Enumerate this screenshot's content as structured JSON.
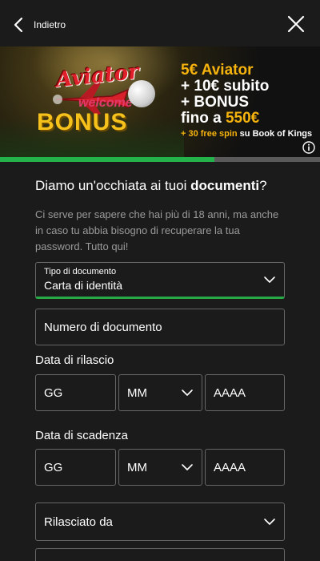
{
  "header": {
    "back_label": "Indietro"
  },
  "banner": {
    "logo_text": "Aviator",
    "welcome_text": "welcome",
    "bonus_text": "BONUS",
    "promo": {
      "line1": "5€ Aviator",
      "line2": "+ 10€ subito",
      "line3": "+ BONUS",
      "line4_prefix": "fino a ",
      "line4_amount": "550€",
      "line5_prefix": "+ 30 free spin",
      "line5_suffix": " su Book of Kings"
    }
  },
  "progress": {
    "value": 0.67,
    "fill_color": "#24b24a",
    "track_color": "#5a5a5a"
  },
  "form": {
    "heading_prefix": "Diamo un'occhiata ai tuoi ",
    "heading_bold": "documenti",
    "heading_suffix": "?",
    "description": "Ci serve per sapere che hai più di 18 anni, ma anche in caso tu abbia bisogno di recuperare la tua password. Tutto qui!",
    "doc_type": {
      "label": "Tipo di documento",
      "value": "Carta di identità"
    },
    "doc_number": {
      "placeholder": "Numero di documento",
      "value": ""
    },
    "issue_date": {
      "label": "Data di rilascio",
      "day_placeholder": "GG",
      "month_value": "MM",
      "year_placeholder": "AAAA"
    },
    "expiry_date": {
      "label": "Data di scadenza",
      "day_placeholder": "GG",
      "month_value": "MM",
      "year_placeholder": "AAAA"
    },
    "issued_by": {
      "value": "Rilasciato da"
    }
  },
  "colors": {
    "background": "#1b1b1b",
    "accent_green": "#27a946",
    "promo_gold": "#f6b30e",
    "field_border": "#666666"
  },
  "icons": [
    "chevron-left-icon",
    "close-icon",
    "info-icon",
    "chevron-down-icon"
  ]
}
